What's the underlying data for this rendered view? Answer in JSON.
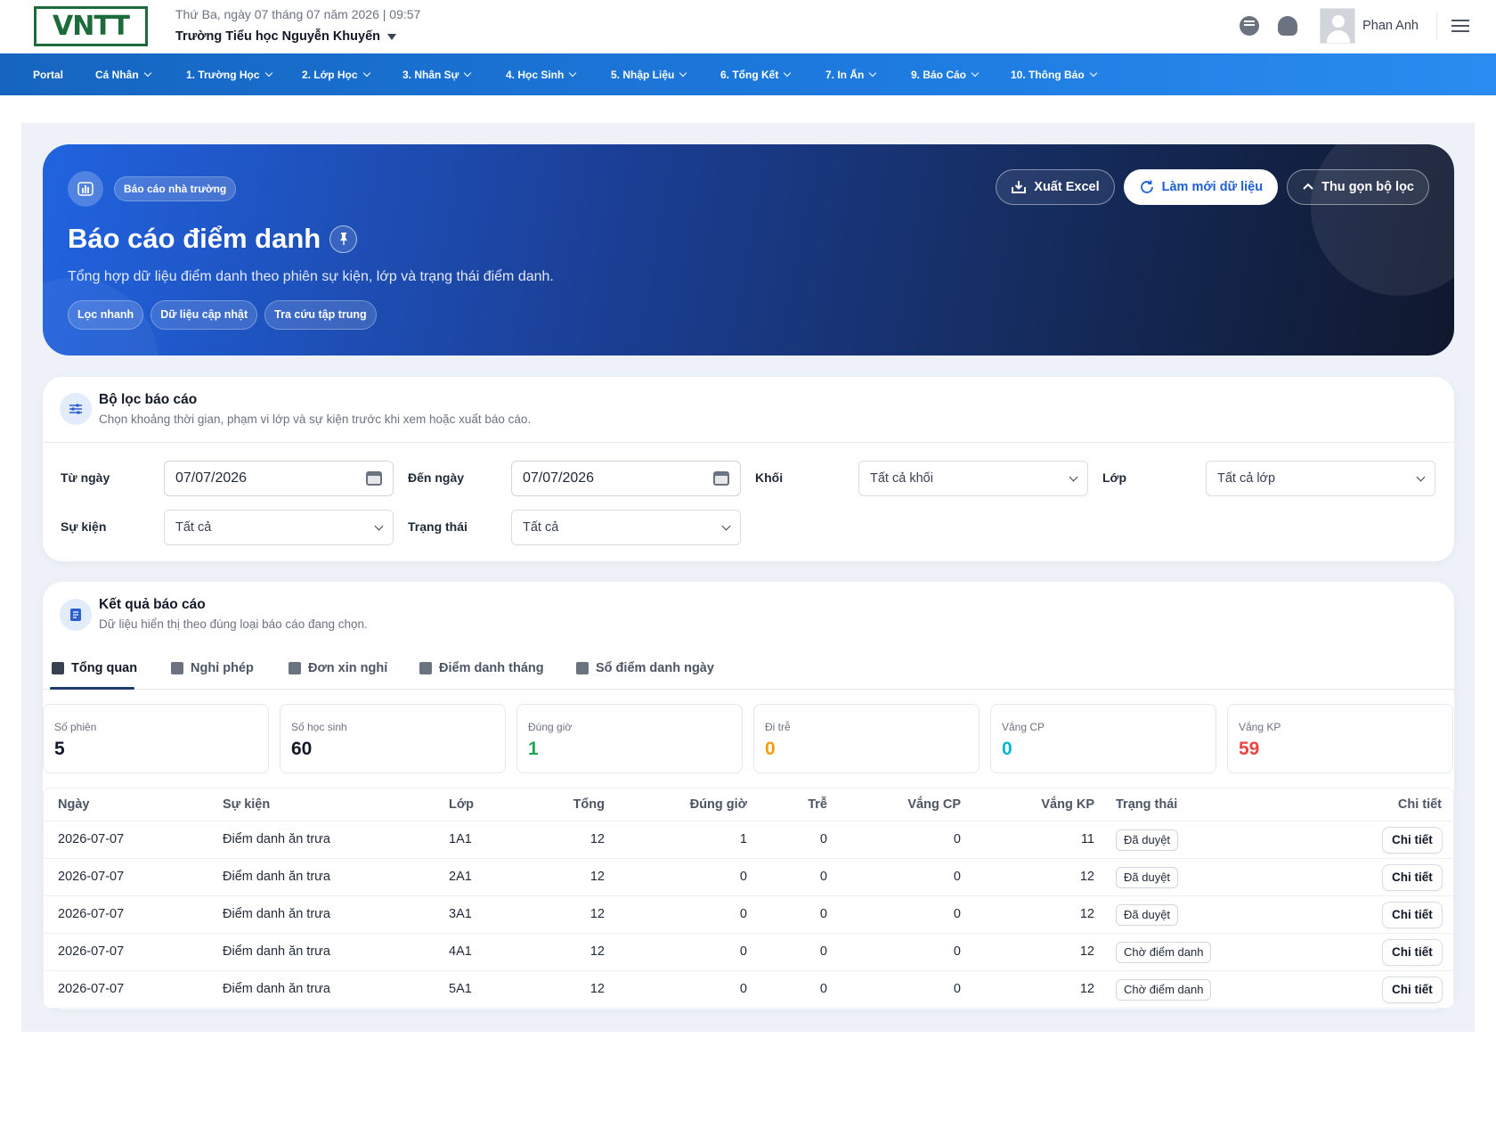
{
  "header": {
    "logo": "VNTT",
    "date_time": "Thứ Ba, ngày 07 tháng 07 năm 2026 | 09:57",
    "school": "Trường Tiểu học Nguyễn Khuyến",
    "user_name": "Phan Anh"
  },
  "nav": [
    "Portal",
    "Cá Nhân",
    "1. Trường Học",
    "2. Lớp Học",
    "3. Nhân Sự",
    "4. Học Sinh",
    "5. Nhập Liệu",
    "6. Tổng Kết",
    "7. In Ấn",
    "9. Báo Cáo",
    "10. Thông Báo"
  ],
  "hero": {
    "badge": "Báo cáo nhà trường",
    "title": "Báo cáo điểm danh",
    "subtitle": "Tổng hợp dữ liệu điểm danh theo phiên sự kiện, lớp và trạng thái điểm danh.",
    "chips": [
      "Lọc nhanh",
      "Dữ liệu cập nhật",
      "Tra cứu tập trung"
    ],
    "btn_export": "Xuất Excel",
    "btn_refresh": "Làm mới dữ liệu",
    "btn_collapse": "Thu gọn bộ lọc"
  },
  "filters": {
    "title": "Bộ lọc báo cáo",
    "subtitle": "Chọn khoảng thời gian, phạm vi lớp và sự kiện trước khi xem hoặc xuất báo cáo.",
    "from_label": "Từ ngày",
    "from_value": "07/07/2026",
    "to_label": "Đến ngày",
    "to_value": "07/07/2026",
    "grade_label": "Khối",
    "grade_value": "Tất cả khối",
    "class_label": "Lớp",
    "class_value": "Tất cả lớp",
    "event_label": "Sự kiện",
    "event_value": "Tất cả",
    "status_label": "Trạng thái",
    "status_value": "Tất cả"
  },
  "results": {
    "title": "Kết quả báo cáo",
    "subtitle": "Dữ liệu hiển thị theo đúng loại báo cáo đang chọn.",
    "tabs": [
      "Tổng quan",
      "Nghỉ phép",
      "Đơn xin nghỉ",
      "Điểm danh tháng",
      "Sổ điểm danh ngày"
    ]
  },
  "stats": [
    {
      "label": "Số phiên",
      "value": "5",
      "color": "#111827"
    },
    {
      "label": "Số học sinh",
      "value": "60",
      "color": "#111827"
    },
    {
      "label": "Đúng giờ",
      "value": "1",
      "color": "#22a55b"
    },
    {
      "label": "Đi trễ",
      "value": "0",
      "color": "#f59e0b"
    },
    {
      "label": "Vắng CP",
      "value": "0",
      "color": "#06b6d4"
    },
    {
      "label": "Vắng KP",
      "value": "59",
      "color": "#ef4444"
    }
  ],
  "table": {
    "headers": [
      "Ngày",
      "Sự kiện",
      "Lớp",
      "Tổng",
      "Đúng giờ",
      "Trễ",
      "Vắng CP",
      "Vắng KP",
      "Trạng thái",
      "Chi tiết"
    ],
    "rows": [
      [
        "2026-07-07",
        "Điểm danh ăn trưa",
        "1A1",
        "12",
        "1",
        "0",
        "0",
        "11",
        "Đã duyệt",
        "Chi tiết"
      ],
      [
        "2026-07-07",
        "Điểm danh ăn trưa",
        "2A1",
        "12",
        "0",
        "0",
        "0",
        "12",
        "Đã duyệt",
        "Chi tiết"
      ],
      [
        "2026-07-07",
        "Điểm danh ăn trưa",
        "3A1",
        "12",
        "0",
        "0",
        "0",
        "12",
        "Đã duyệt",
        "Chi tiết"
      ],
      [
        "2026-07-07",
        "Điểm danh ăn trưa",
        "4A1",
        "12",
        "0",
        "0",
        "0",
        "12",
        "Chờ điểm danh",
        "Chi tiết"
      ],
      [
        "2026-07-07",
        "Điểm danh ăn trưa",
        "5A1",
        "12",
        "0",
        "0",
        "0",
        "12",
        "Chờ điểm danh",
        "Chi tiết"
      ]
    ]
  }
}
